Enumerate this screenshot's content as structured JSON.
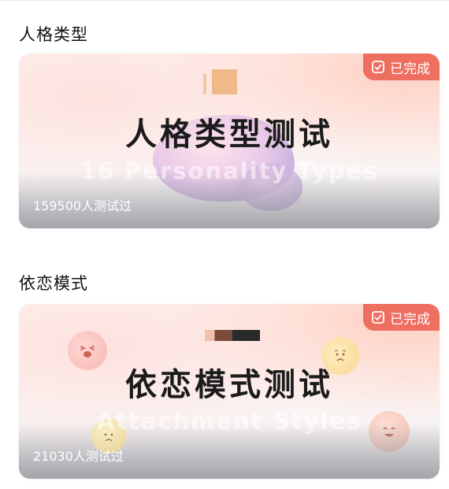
{
  "sections": [
    {
      "heading": "人格类型",
      "card": {
        "title": "人格类型测试",
        "subtitle": "16 Personality Types",
        "count": "159500人测试过",
        "badge": "已完成"
      }
    },
    {
      "heading": "依恋模式",
      "card": {
        "title": "依恋模式测试",
        "subtitle": "Attachment Styles",
        "count": "21030人测试过",
        "badge": "已完成"
      }
    }
  ],
  "colors": {
    "badge": "#ee6e60",
    "title": "#1b1b1b"
  },
  "icons": {
    "badge": "completed-check-icon",
    "faces": [
      "laughing-face-icon",
      "worried-face-icon",
      "smiling-face-icon",
      "crying-face-icon"
    ]
  }
}
